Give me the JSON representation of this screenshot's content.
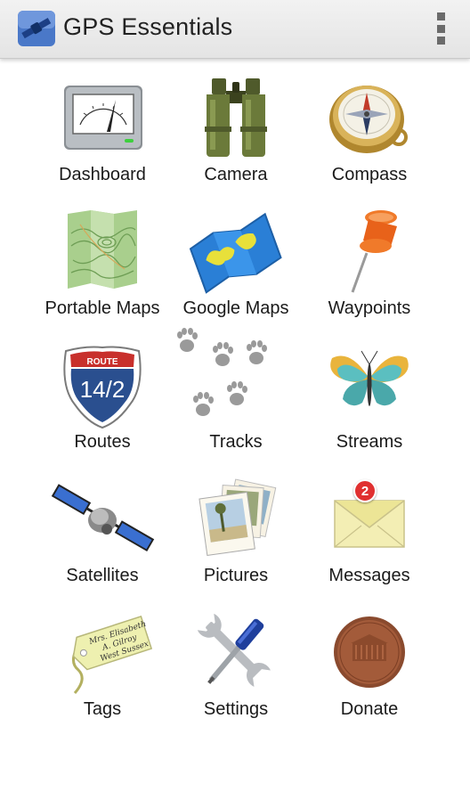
{
  "app_bar": {
    "title": "GPS Essentials",
    "icon": "gps-essentials-app-icon",
    "overflow_icon": "overflow-menu-icon"
  },
  "tiles": [
    {
      "label": "Dashboard",
      "icon": "dashboard-gauge-icon"
    },
    {
      "label": "Camera",
      "icon": "binoculars-icon"
    },
    {
      "label": "Compass",
      "icon": "compass-icon"
    },
    {
      "label": "Portable Maps",
      "icon": "topographic-map-icon"
    },
    {
      "label": "Google Maps",
      "icon": "folded-map-icon"
    },
    {
      "label": "Waypoints",
      "icon": "push-pin-icon"
    },
    {
      "label": "Routes",
      "icon": "route-shield-icon",
      "shield_top": "ROUTE",
      "shield_number": "14/2"
    },
    {
      "label": "Tracks",
      "icon": "paw-prints-icon"
    },
    {
      "label": "Streams",
      "icon": "butterfly-icon"
    },
    {
      "label": "Satellites",
      "icon": "satellite-icon"
    },
    {
      "label": "Pictures",
      "icon": "photo-stack-icon"
    },
    {
      "label": "Messages",
      "icon": "envelope-icon",
      "badge_count": "2"
    },
    {
      "label": "Tags",
      "icon": "luggage-tag-icon",
      "tag_lines": [
        "Mrs. Elisabeth",
        "A. Gilroy",
        "West Sussex"
      ]
    },
    {
      "label": "Settings",
      "icon": "wrench-screwdriver-icon"
    },
    {
      "label": "Donate",
      "icon": "penny-coin-icon"
    }
  ],
  "colors": {
    "app_bar_bg": "#e9e9e9",
    "badge": "#e03030",
    "route_shield_blue": "#2a4f8f",
    "route_shield_red": "#c8302c"
  }
}
